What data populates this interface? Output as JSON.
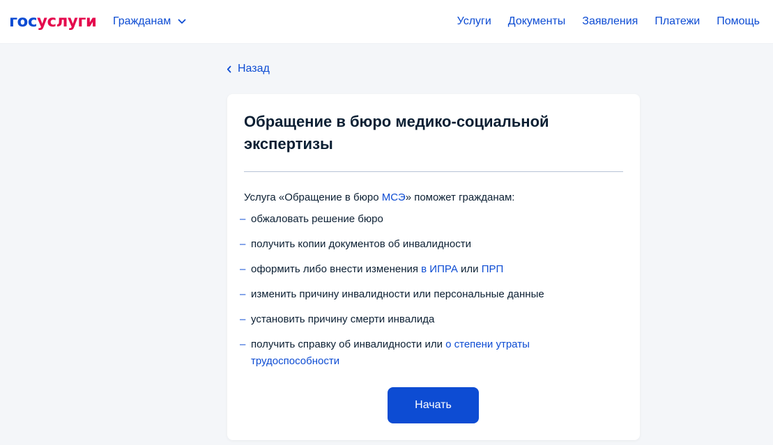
{
  "header": {
    "logo_part1": "гос",
    "logo_part2": "услуги",
    "citizens_label": "Гражданам",
    "nav": [
      "Услуги",
      "Документы",
      "Заявления",
      "Платежи",
      "Помощь"
    ]
  },
  "back_label": "Назад",
  "card": {
    "title": "Обращение в бюро медико-социальной экспертизы",
    "intro": {
      "before": "Услуга «Обращение в бюро ",
      "link": "МСЭ",
      "after": "» поможет гражданам:"
    },
    "items": {
      "i0": "обжаловать решение бюро",
      "i1": "получить копии документов об инвалидности",
      "i2": {
        "a": "оформить либо внести изменения ",
        "link1": "в ИПРА",
        "b": " или ",
        "link2": "ПРП"
      },
      "i3": "изменить причину инвалидности или персональные данные",
      "i4": "установить причину смерти инвалида",
      "i5": {
        "a": "получить справку об инвалидности или ",
        "link": "о степени утраты",
        "line2": "трудоспособности"
      }
    },
    "dash": "–",
    "start_button": "Начать"
  },
  "colors": {
    "brand_blue": "#0d4cd3",
    "brand_red": "#e4094d",
    "background": "#f4f6f9",
    "text": "#0b1f33"
  },
  "icons": {
    "citizens_menu": "chevron-down-icon",
    "back": "chevron-left-icon"
  }
}
